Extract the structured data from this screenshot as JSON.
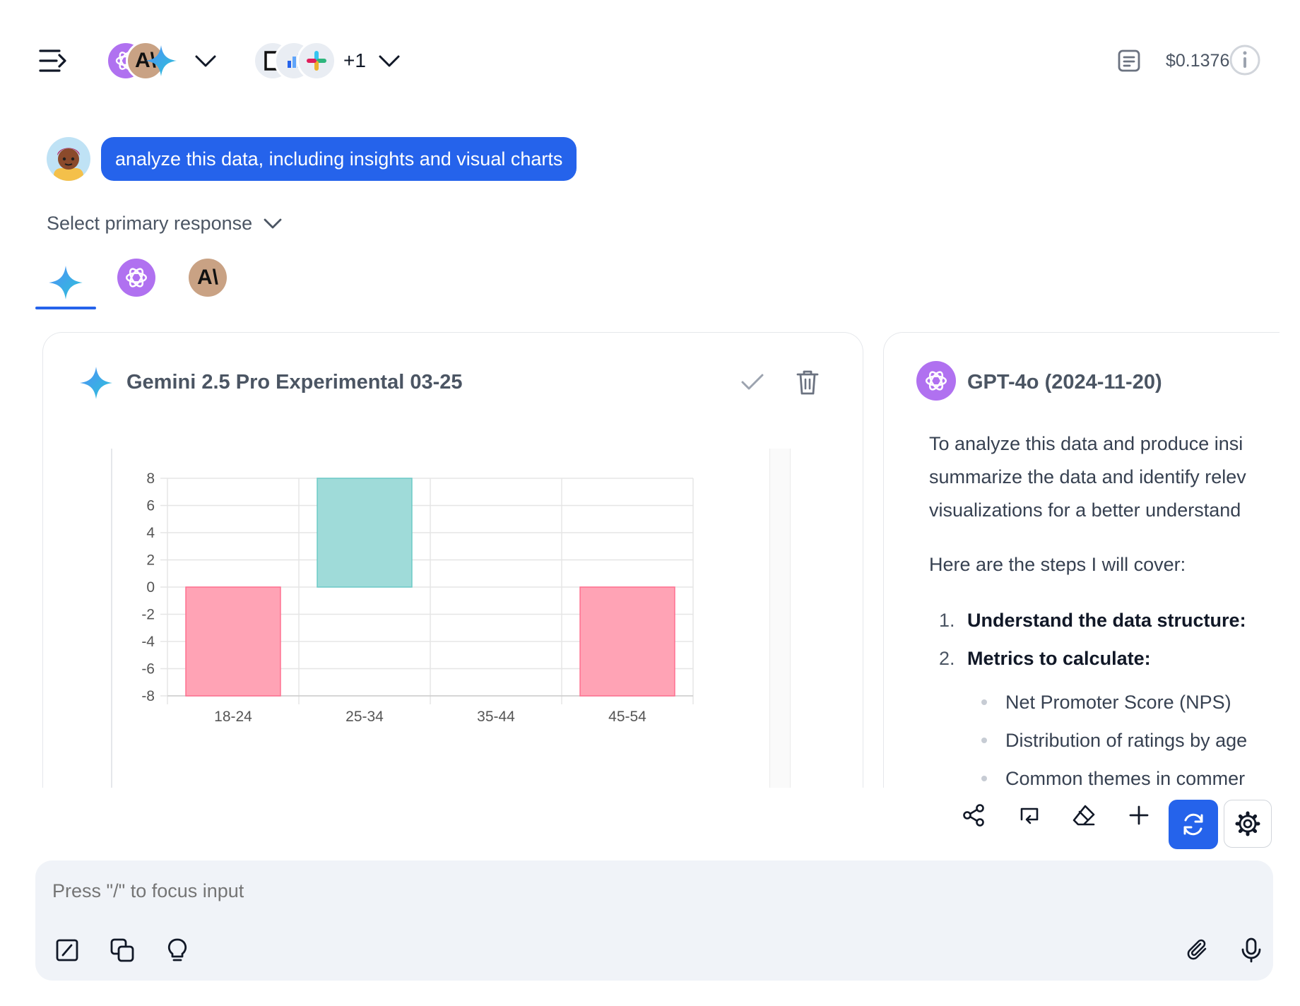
{
  "header": {
    "extra_tools_count": "+1",
    "cost": "$0.1376"
  },
  "prompt": {
    "text": "analyze this data, including insights and visual charts"
  },
  "select_primary": {
    "label": "Select primary response"
  },
  "cards": {
    "gemini": {
      "title": "Gemini 2.5 Pro Experimental 03-25"
    },
    "gpt": {
      "title": "GPT-4o (2024-11-20)",
      "intro_lines": [
        "To analyze this data and produce insi",
        "summarize the data and identify relev",
        "visualizations for a better understand"
      ],
      "steps_intro": "Here are the steps I will cover:",
      "steps": [
        {
          "num": "1.",
          "text": "Understand the data structure:"
        },
        {
          "num": "2.",
          "text": "Metrics to calculate:"
        }
      ],
      "bullets": [
        "Net Promoter Score (NPS)",
        "Distribution of ratings by age",
        "Common themes in commer"
      ]
    }
  },
  "chart_data": {
    "type": "bar",
    "categories": [
      "18-24",
      "25-34",
      "35-44",
      "45-54"
    ],
    "values": [
      -8,
      8,
      0,
      -8
    ],
    "ylim": [
      -8,
      8
    ],
    "yticks": [
      "8",
      "6",
      "4",
      "2",
      "0",
      "-2",
      "-4",
      "-6",
      "-8"
    ],
    "grid": true,
    "colors": {
      "positive": "#9fdbd9",
      "negative": "#ffa3b5",
      "positive_border": "#6ccac7",
      "negative_border": "#ff6f8f"
    }
  },
  "input": {
    "placeholder": "Press \"/\" to focus input"
  },
  "colors": {
    "accent": "#2563eb",
    "input_bg": "#f0f3f8"
  }
}
